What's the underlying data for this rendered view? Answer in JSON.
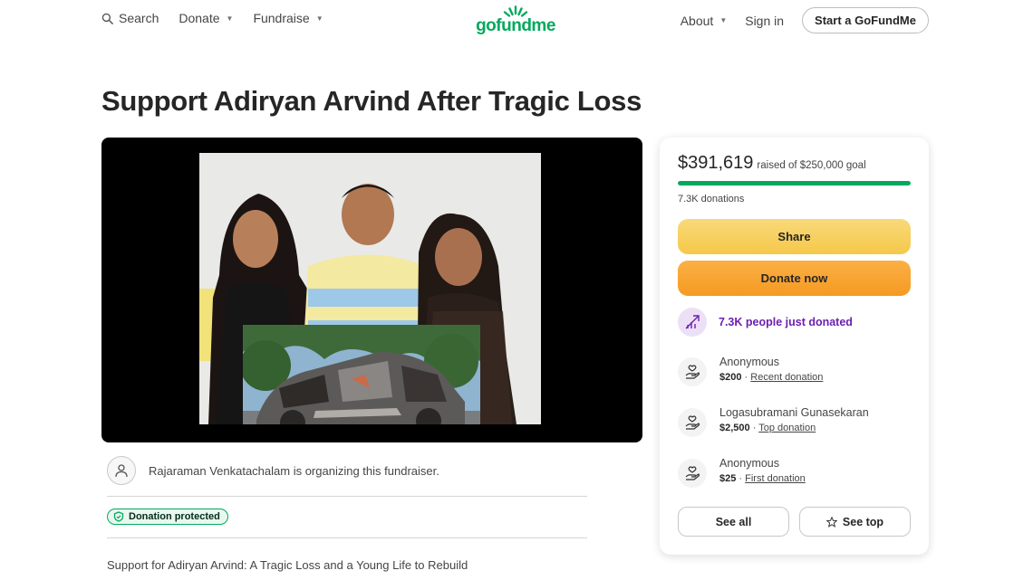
{
  "header": {
    "search_label": "Search",
    "donate_label": "Donate",
    "fundraise_label": "Fundraise",
    "logo_text": "gofundme",
    "about_label": "About",
    "signin_label": "Sign in",
    "start_label": "Start a GoFundMe"
  },
  "page_title": "Support Adiryan Arvind After Tragic Loss",
  "organizer": {
    "text": "Rajaraman Venkatachalam is organizing this fundraiser."
  },
  "badge": {
    "label": "Donation protected"
  },
  "story": {
    "first_line": "Support for Adiryan Arvind: A Tragic Loss and a Young Life to Rebuild"
  },
  "card": {
    "raised": "$391,619",
    "goal_text": "raised of $250,000 goal",
    "progress_fraction": 1.0,
    "donations": "7.3K donations",
    "share_label": "Share",
    "donate_label": "Donate now",
    "trend_text": "7.3K people just donated",
    "donors": [
      {
        "name": "Anonymous",
        "amount": "$200",
        "tag": "Recent donation"
      },
      {
        "name": "Logasubramani Gunasekaran",
        "amount": "$2,500",
        "tag": "Top donation"
      },
      {
        "name": "Anonymous",
        "amount": "$25",
        "tag": "First donation"
      }
    ],
    "see_all_label": "See all",
    "see_top_label": "See top"
  },
  "colors": {
    "brand_green": "#02a95c",
    "share_yellow": "#f6c84a",
    "donate_orange": "#f59a22",
    "trend_purple": "#6c1fb0"
  },
  "icons": [
    "search-icon",
    "chevron-down-icon",
    "user-icon",
    "shield-icon",
    "trending-icon",
    "donation-hand-icon",
    "star-icon"
  ]
}
